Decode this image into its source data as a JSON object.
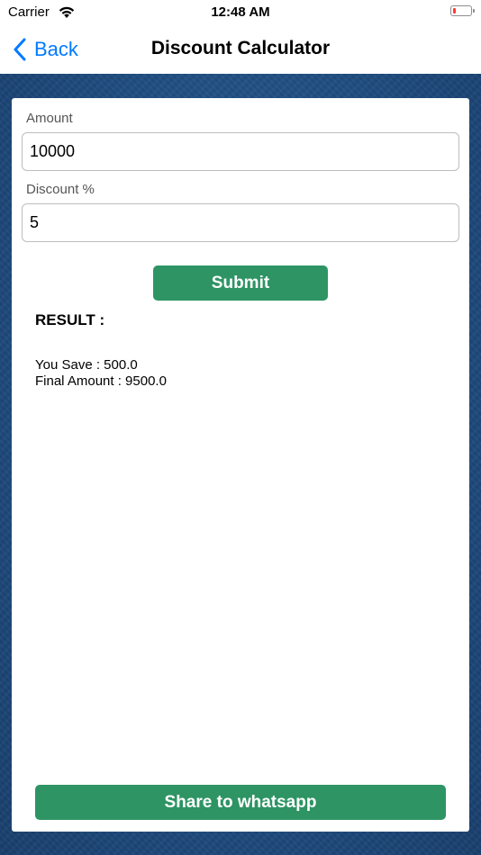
{
  "status_bar": {
    "carrier": "Carrier",
    "time": "12:48 AM",
    "battery_color": "#ff3b30"
  },
  "nav": {
    "back_label": "Back",
    "title": "Discount Calculator",
    "accent_color": "#007aff"
  },
  "form": {
    "amount_label": "Amount",
    "amount_value": "10000",
    "discount_label": "Discount %",
    "discount_value": "5",
    "submit_label": "Submit"
  },
  "result": {
    "title": "RESULT :",
    "you_save": "You Save : 500.0",
    "final_amount": "Final Amount : 9500.0"
  },
  "share": {
    "label": "Share to whatsapp"
  },
  "colors": {
    "button_green": "#2e9464",
    "background_blue": "#1f4c80"
  }
}
